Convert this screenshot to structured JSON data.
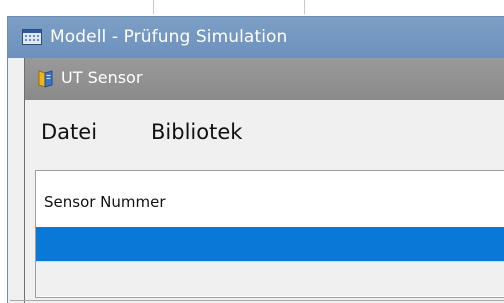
{
  "outer_window": {
    "title": "Modell - Prüfung Simulation",
    "icon": "window-icon"
  },
  "inner_window": {
    "title": "UT Sensor",
    "icon": "book-icon"
  },
  "menu": {
    "items": [
      {
        "label": "Datei"
      },
      {
        "label": "Bibliotek"
      }
    ]
  },
  "list": {
    "header_label": "Sensor Nummer",
    "selected_row_text": "",
    "empty_row_text": ""
  },
  "colors": {
    "outer_titlebar": "#7196c0",
    "inner_titlebar": "#929292",
    "selection": "#0a78d7"
  }
}
